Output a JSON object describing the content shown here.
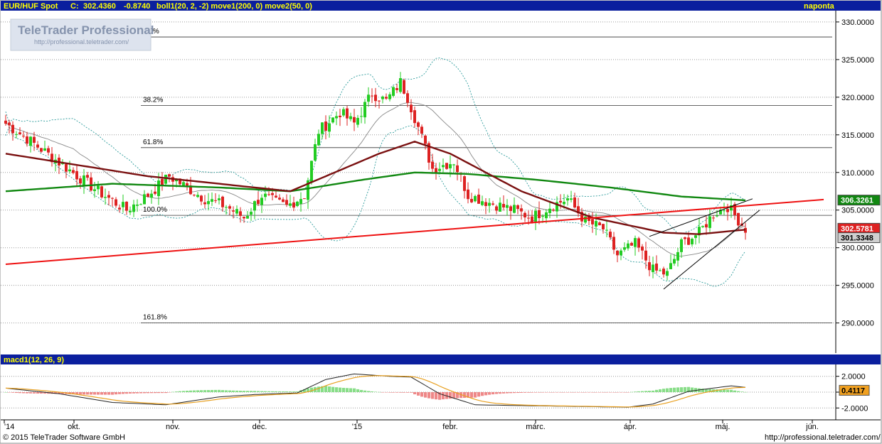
{
  "header": {
    "symbol": "EUR/HUF Spot",
    "close_label": "C:",
    "close_value": "302.4360",
    "change": "-0.8740",
    "indicators": "boll1(20, 2, -2) move1(200, 0) move2(50, 0)",
    "period": "naponta"
  },
  "watermark": {
    "brand": "TeleTrader Professional",
    "url": "http://professional.teletrader.com/"
  },
  "macd_header": {
    "label": "macd1(12, 26, 9)"
  },
  "footer": {
    "copyright": "© 2015 TeleTrader Software GmbH",
    "url": "http://professional.teletrader.com/"
  },
  "colors": {
    "header_bg": "#0b1f9e",
    "header_text": "#ffff00",
    "up": "#22cc22",
    "down": "#dd2222",
    "ma200": "#118811",
    "ma50": "#7a1010",
    "trend": "#ee1111"
  },
  "chart_data": {
    "type": "candlestick",
    "price_axis": {
      "ticks": [
        290,
        295,
        300,
        305,
        310,
        315,
        320,
        325,
        330
      ],
      "tick_labels": [
        "290.0000",
        "295.0000",
        "300.0000",
        "305.0000",
        "310.0000",
        "315.0000",
        "320.0000",
        "325.0000",
        "330.0000"
      ],
      "ylim": [
        286,
        331.5
      ]
    },
    "macd_axis": {
      "ticks": [
        2,
        0,
        -2
      ],
      "tick_labels": [
        "2.0000",
        "0",
        "-2.0000"
      ],
      "ylim": [
        -3.5,
        3.5
      ]
    },
    "x_axis": {
      "labels": [
        "'14",
        "okt.",
        "nov.",
        "dec.",
        "'15",
        "febr.",
        "márc.",
        "ápr.",
        "máj.",
        "jún."
      ]
    },
    "value_labels": {
      "ma200": {
        "text": "306.3261",
        "value": 306.3261
      },
      "close": {
        "text": "302.5781",
        "value": 302.5781
      },
      "ma50": {
        "text": "301.3348",
        "value": 301.3348
      },
      "macd": {
        "text": "0.4117",
        "value": 0.4117
      }
    },
    "fibonacci": [
      {
        "label": "0.0%",
        "value": 328.0
      },
      {
        "label": "38.2%",
        "value": 318.9
      },
      {
        "label": "61.8%",
        "value": 313.3
      },
      {
        "label": "100.0%",
        "value": 304.3
      },
      {
        "label": "161.8%",
        "value": 290.0
      }
    ],
    "anchors": [
      [
        0,
        316.5
      ],
      [
        6,
        314.5
      ],
      [
        16,
        311
      ],
      [
        26,
        307.5
      ],
      [
        34,
        305
      ],
      [
        40,
        307
      ],
      [
        46,
        309.5
      ],
      [
        51,
        308
      ],
      [
        56,
        306.5
      ],
      [
        62,
        305.5
      ],
      [
        67,
        304
      ],
      [
        72,
        307
      ],
      [
        76,
        306
      ],
      [
        79,
        305.5
      ],
      [
        84,
        307
      ],
      [
        88,
        315.5
      ],
      [
        94,
        318
      ],
      [
        98,
        316.5
      ],
      [
        103,
        320.5
      ],
      [
        107,
        319.5
      ],
      [
        111,
        322
      ],
      [
        113,
        320
      ],
      [
        116,
        316
      ],
      [
        120,
        310.5
      ],
      [
        126,
        311.5
      ],
      [
        130,
        307
      ],
      [
        136,
        306
      ],
      [
        143,
        305
      ],
      [
        148,
        304
      ],
      [
        153,
        305.5
      ],
      [
        158,
        306.5
      ],
      [
        163,
        303.5
      ],
      [
        168,
        302.5
      ],
      [
        172,
        299
      ],
      [
        177,
        300.5
      ],
      [
        182,
        297
      ],
      [
        186,
        296.5
      ],
      [
        190,
        300.5
      ],
      [
        195,
        302
      ],
      [
        199,
        304.5
      ],
      [
        203,
        305.5
      ],
      [
        208,
        302.5
      ]
    ],
    "ma200": [
      [
        0,
        307.5
      ],
      [
        30,
        308.5
      ],
      [
        60,
        308
      ],
      [
        80,
        307.5
      ],
      [
        100,
        309
      ],
      [
        115,
        310
      ],
      [
        130,
        309.8
      ],
      [
        150,
        309
      ],
      [
        170,
        308
      ],
      [
        190,
        306.8
      ],
      [
        208,
        306.3
      ]
    ],
    "ma50": [
      [
        0,
        312.5
      ],
      [
        20,
        311
      ],
      [
        40,
        309.5
      ],
      [
        60,
        308.5
      ],
      [
        80,
        307.5
      ],
      [
        95,
        310.5
      ],
      [
        105,
        312.5
      ],
      [
        115,
        314.1
      ],
      [
        125,
        312.5
      ],
      [
        145,
        307.5
      ],
      [
        165,
        304
      ],
      [
        185,
        302
      ],
      [
        195,
        301.8
      ],
      [
        208,
        302.4
      ]
    ],
    "trendline": {
      "from": [
        0,
        297.8
      ],
      "to": [
        230,
        306.4
      ]
    },
    "wedge_upper": {
      "from": [
        181,
        301.5
      ],
      "to": [
        210,
        306.5
      ]
    },
    "wedge_lower": {
      "from": [
        185,
        294.5
      ],
      "to": [
        212,
        305
      ]
    },
    "macd_anchors": [
      [
        0,
        0.5
      ],
      [
        15,
        -0.2
      ],
      [
        30,
        -1.3
      ],
      [
        45,
        -1.6
      ],
      [
        60,
        -0.6
      ],
      [
        70,
        -0.3
      ],
      [
        82,
        -0.1
      ],
      [
        90,
        1.6
      ],
      [
        98,
        2.3
      ],
      [
        108,
        2.0
      ],
      [
        114,
        1.9
      ],
      [
        122,
        -0.2
      ],
      [
        132,
        -1.6
      ],
      [
        145,
        -1.7
      ],
      [
        160,
        -1.8
      ],
      [
        175,
        -1.9
      ],
      [
        182,
        -1.5
      ],
      [
        192,
        0.1
      ],
      [
        204,
        0.8
      ],
      [
        210,
        0.5
      ]
    ]
  }
}
